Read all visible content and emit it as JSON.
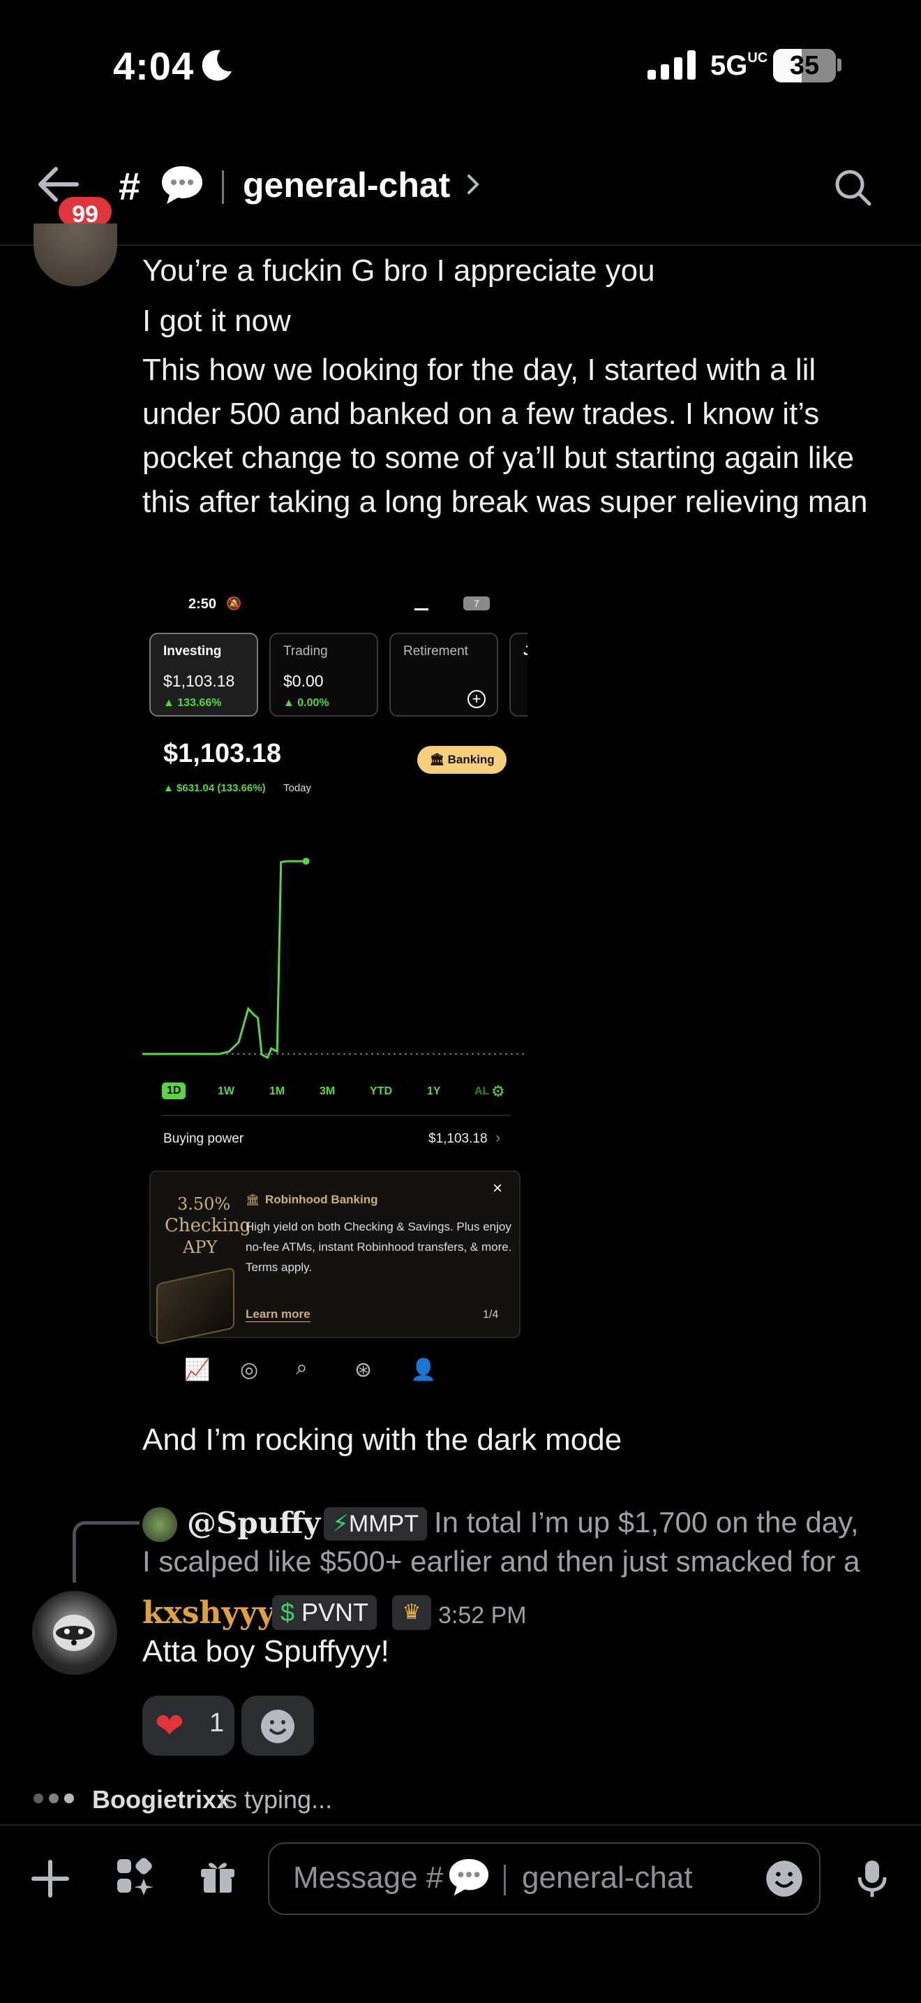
{
  "status_bar": {
    "time": "4:04",
    "network": "5G",
    "network_suffix": "UC",
    "battery": "35"
  },
  "header": {
    "back_badge": "99",
    "hash": "#",
    "channel_name": "general-chat"
  },
  "messages": {
    "line1": "You’re a fuckin G bro I appreciate you",
    "line2": "I got it now",
    "line3": "This how we looking for the day, I started with a lil under 500 and banked on a few trades. I know it’s pocket change to some of ya’ll but starting again like this after taking a long break was super relieving man",
    "line4": "And I’m rocking with the dark mode"
  },
  "attachment": {
    "time": "2:50",
    "battery": "7",
    "cards": [
      {
        "label": "Investing",
        "value": "$1,103.18",
        "change": "▲ 133.66%"
      },
      {
        "label": "Trading",
        "value": "$0.00",
        "change": "▲ 0.00%"
      },
      {
        "label": "Retirement"
      },
      {
        "label": "J"
      }
    ],
    "balance": "$1,103.18",
    "change": "▲ $631.04 (133.66%)",
    "change_suffix": "Today",
    "banking_label": "Banking",
    "timeframes": [
      "1D",
      "1W",
      "1M",
      "3M",
      "YTD",
      "1Y",
      "AL"
    ],
    "buying_power_label": "Buying power",
    "buying_power_value": "$1,103.18",
    "promo": {
      "rate": "3.50%",
      "rate_line2": "Checking",
      "rate_line3": "APY",
      "title": "Robinhood Banking",
      "body": "High yield on both Checking & Savings. Plus enjoy no-fee ATMs, instant Robinhood transfers, & more. Terms apply.",
      "cta": "Learn more",
      "pager": "1/4"
    },
    "chart_data": {
      "type": "line",
      "title": "",
      "xlabel": "",
      "ylabel": "",
      "x": [
        0,
        10,
        20,
        30,
        40,
        45,
        50,
        55,
        58,
        60,
        62,
        65,
        67,
        70,
        72,
        75,
        78,
        80,
        85
      ],
      "y": [
        472,
        472,
        472,
        472,
        472,
        480,
        510,
        620,
        600,
        590,
        470,
        460,
        490,
        480,
        1100,
        1103,
        1103,
        1103,
        1103
      ],
      "series_color": "#5ad442"
    }
  },
  "reply": {
    "name": "@Spuffy",
    "tag_icon": "⚡",
    "tag": "MMPT",
    "text": "In total I’m up $1,700 on the day, I scalped like $500+ earlier and then just smacked for a …"
  },
  "author": {
    "name": "kxshyyy",
    "role_tag": "PVNT",
    "crown": "♛",
    "time": "3:52 PM"
  },
  "message5": "Atta boy Spuffyyy!",
  "reactions": {
    "heart": "❤️",
    "heart_count": "1"
  },
  "typing": {
    "user": "Boogietrixx",
    "suffix": "is typing..."
  },
  "composer": {
    "placeholder_prefix": "Message #",
    "placeholder_channel": "general-chat"
  }
}
